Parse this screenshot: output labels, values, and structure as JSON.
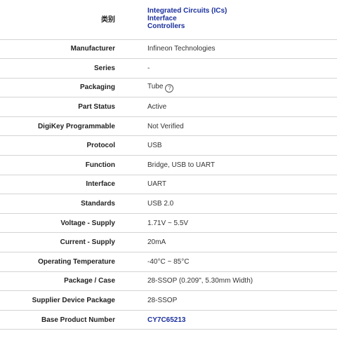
{
  "category": {
    "label": "类别",
    "links": [
      "Integrated Circuits (ICs)",
      "Interface",
      "Controllers"
    ]
  },
  "rows": [
    {
      "label": "Manufacturer",
      "value": "Infineon Technologies"
    },
    {
      "label": "Series",
      "value": "-"
    },
    {
      "label": "Packaging",
      "value": "Tube"
    },
    {
      "label": "Part Status",
      "value": "Active"
    },
    {
      "label": "DigiKey Programmable",
      "value": "Not Verified"
    },
    {
      "label": "Protocol",
      "value": "USB"
    },
    {
      "label": "Function",
      "value": "Bridge, USB to UART"
    },
    {
      "label": "Interface",
      "value": "UART"
    },
    {
      "label": "Standards",
      "value": "USB 2.0"
    },
    {
      "label": "Voltage - Supply",
      "value": "1.71V ~ 5.5V"
    },
    {
      "label": "Current - Supply",
      "value": "20mA"
    },
    {
      "label": "Operating Temperature",
      "value": "-40°C ~ 85°C"
    },
    {
      "label": "Package / Case",
      "value": "28-SSOP (0.209\", 5.30mm Width)"
    },
    {
      "label": "Supplier Device Package",
      "value": "28-SSOP"
    },
    {
      "label": "Base Product Number",
      "value": "CY7C65213"
    }
  ],
  "help_icon_glyph": "?",
  "colors": {
    "link": "#1a2f9c",
    "divider": "#d4d4d4"
  }
}
